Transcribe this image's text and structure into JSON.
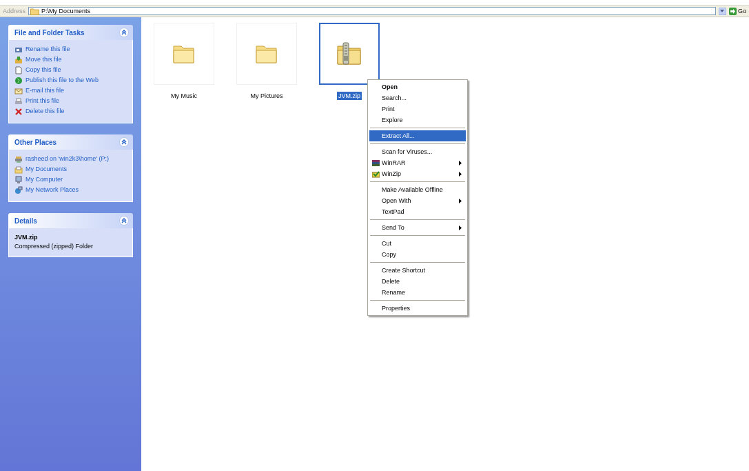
{
  "address_bar": {
    "label": "Address",
    "path": "P:\\My Documents",
    "go_label": "Go"
  },
  "sidebar": {
    "panels": [
      {
        "kind": "tasks",
        "title": "File and Folder Tasks",
        "expanded": true,
        "items": [
          {
            "label": "Rename this file"
          },
          {
            "label": "Move this file"
          },
          {
            "label": "Copy this file"
          },
          {
            "label": "Publish this file to the Web"
          },
          {
            "label": "E-mail this file"
          },
          {
            "label": "Print this file"
          },
          {
            "label": "Delete this file"
          }
        ]
      },
      {
        "kind": "places",
        "title": "Other Places",
        "expanded": true,
        "items": [
          {
            "label": "rasheed on 'win2k3\\home' (P:)"
          },
          {
            "label": "My Documents"
          },
          {
            "label": "My Computer"
          },
          {
            "label": "My Network Places"
          }
        ]
      },
      {
        "kind": "details",
        "title": "Details",
        "expanded": true,
        "name": "JVM.zip",
        "description": "Compressed (zipped) Folder"
      }
    ]
  },
  "files": [
    {
      "kind": "folder",
      "label": "My Music",
      "selected": false
    },
    {
      "kind": "folder",
      "label": "My Pictures",
      "selected": false
    },
    {
      "kind": "zip",
      "label": "JVM.zip",
      "selected": true
    }
  ],
  "context_menu": [
    {
      "kind": "item",
      "label": "Open",
      "default": true,
      "selected": false,
      "submenu": false
    },
    {
      "kind": "item",
      "label": "Search...",
      "default": false,
      "selected": false,
      "submenu": false
    },
    {
      "kind": "item",
      "label": "Print",
      "default": false,
      "selected": false,
      "submenu": false
    },
    {
      "kind": "item",
      "label": "Explore",
      "default": false,
      "selected": false,
      "submenu": false
    },
    {
      "kind": "separator"
    },
    {
      "kind": "item",
      "label": "Extract All...",
      "default": false,
      "selected": true,
      "submenu": false
    },
    {
      "kind": "separator"
    },
    {
      "kind": "item",
      "label": "Scan for Viruses...",
      "default": false,
      "selected": false,
      "submenu": false
    },
    {
      "kind": "books",
      "label": "WinRAR",
      "default": false,
      "selected": false,
      "submenu": true
    },
    {
      "kind": "vise",
      "label": "WinZip",
      "default": false,
      "selected": false,
      "submenu": true
    },
    {
      "kind": "separator"
    },
    {
      "kind": "item",
      "label": "Make Available Offline",
      "default": false,
      "selected": false,
      "submenu": false
    },
    {
      "kind": "item",
      "label": "Open With",
      "default": false,
      "selected": false,
      "submenu": true
    },
    {
      "kind": "item",
      "label": "TextPad",
      "default": false,
      "selected": false,
      "submenu": false
    },
    {
      "kind": "separator"
    },
    {
      "kind": "item",
      "label": "Send To",
      "default": false,
      "selected": false,
      "submenu": true
    },
    {
      "kind": "separator"
    },
    {
      "kind": "item",
      "label": "Cut",
      "default": false,
      "selected": false,
      "submenu": false
    },
    {
      "kind": "item",
      "label": "Copy",
      "default": false,
      "selected": false,
      "submenu": false
    },
    {
      "kind": "separator"
    },
    {
      "kind": "item",
      "label": "Create Shortcut",
      "default": false,
      "selected": false,
      "submenu": false
    },
    {
      "kind": "item",
      "label": "Delete",
      "default": false,
      "selected": false,
      "submenu": false
    },
    {
      "kind": "item",
      "label": "Rename",
      "default": false,
      "selected": false,
      "submenu": false
    },
    {
      "kind": "separator"
    },
    {
      "kind": "item",
      "label": "Properties",
      "default": false,
      "selected": false,
      "submenu": false
    }
  ]
}
